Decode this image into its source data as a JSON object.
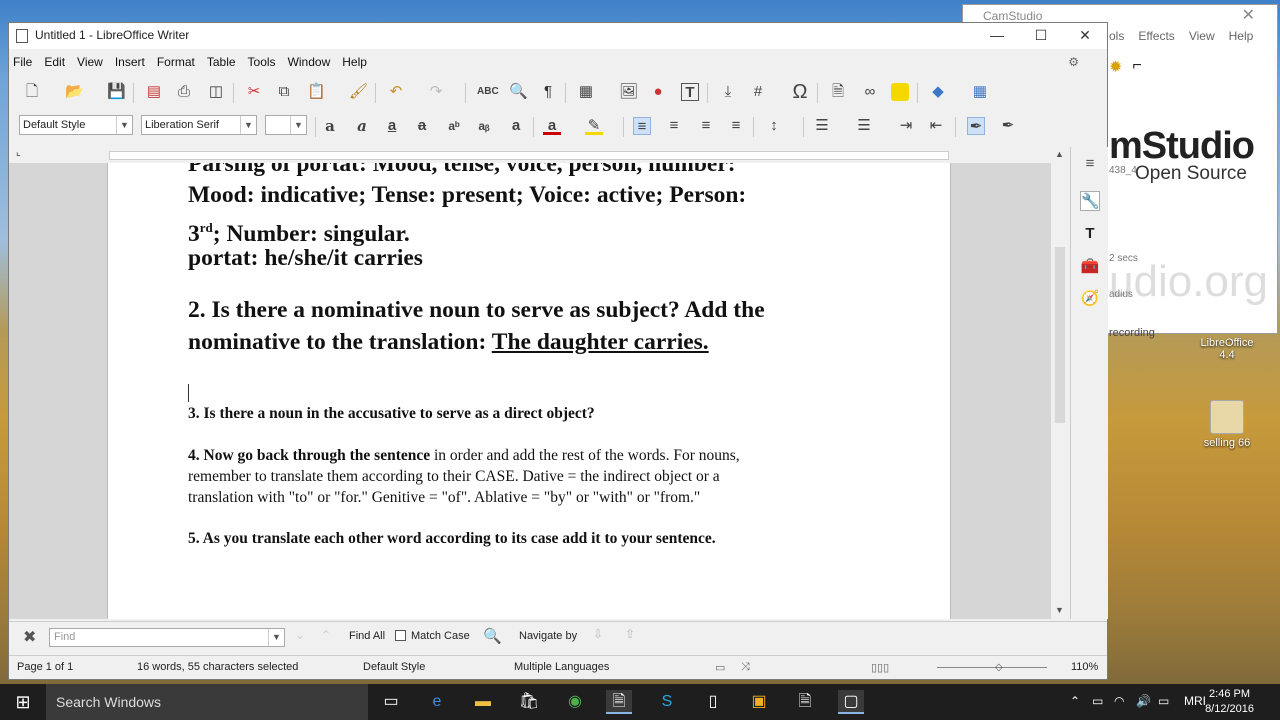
{
  "desktop": {
    "icons": [
      {
        "label": "LibreOffice\n4.4"
      },
      {
        "label": "selling 66"
      }
    ]
  },
  "camstudio": {
    "title": "CamStudio",
    "menus": [
      "ols",
      "Effects",
      "View",
      "Help"
    ],
    "brand_main": "mStudio",
    "brand_sub": "Open Source",
    "brand_url": "udio.org",
    "frag1": "438_4",
    "frag2": "2 secs",
    "frag3": "adius",
    "recording_text": "recording"
  },
  "writer": {
    "title": "Untitled 1 - LibreOffice Writer",
    "menu": [
      "File",
      "Edit",
      "View",
      "Insert",
      "Format",
      "Table",
      "Tools",
      "Window",
      "Help"
    ],
    "paragraph_style": "Default Style",
    "font_name": "Liberation Serif",
    "font_size": "",
    "doc": {
      "line_cut": "Parsing of portat: Mood, tense, voice, person, number:",
      "line1": "Mood: indicative; Tense: present; Voice: active; Person:",
      "line2_pre": "3",
      "line2_sup": "rd",
      "line2_post": "; Number: singular.",
      "line3": "portat: he/she/it carries",
      "q2_line1": "2. Is there a nominative noun to serve as subject? Add the",
      "q2_line2_pre": "nominative to the translation: ",
      "q2_line2_ul": "The daughter carries.",
      "q3": "3. Is there a noun in the accusative to serve as a direct object?",
      "q4_bold": "4. Now go back through the sentence",
      "q4_rest1": " in order and add the rest of the words. For nouns,",
      "q4_line2": "remember to translate them according to their CASE. Dative = the indirect object or a",
      "q4_line3": "translation with \"to\" or \"for.\" Genitive = \"of\". Ablative = \"by\" or \"with\" or \"from.\"",
      "q5": "5. As you translate each other word according to its case add it to your sentence."
    },
    "findbar": {
      "placeholder": "Find",
      "find_all": "Find All",
      "match_case": "Match Case",
      "navigate_by": "Navigate by"
    },
    "status": {
      "page": "Page 1 of 1",
      "words": "16 words, 55 characters selected",
      "style": "Default Style",
      "language": "Multiple Languages",
      "zoom": "110%"
    }
  },
  "taskbar": {
    "search_placeholder": "Search Windows",
    "tray_lang": "MRI",
    "time": "2:46 PM",
    "date": "8/12/2016"
  },
  "colors": {
    "accent": "#3c7fc8",
    "taskbar": "#1e1e1e"
  }
}
